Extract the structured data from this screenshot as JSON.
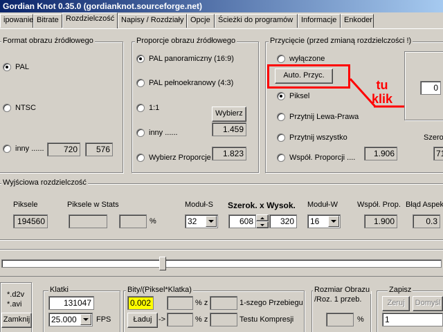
{
  "window": {
    "title": "Gordian Knot 0.35.0  (gordianknot.sourceforge.net)"
  },
  "tabs": [
    "ipowanie",
    "Bitrate",
    "Rozdzielczość",
    "Napisy / Rozdziały",
    "Opcje",
    "Ścieżki do programów",
    "Informacje",
    "Enkoder"
  ],
  "source_format": {
    "title": "Format obrazu źródłowego",
    "options": [
      "PAL",
      "NTSC",
      "inny ......"
    ],
    "selected": "PAL",
    "custom_width": "720",
    "custom_height": "576"
  },
  "source_aspect": {
    "title": "Proporcje obrazu źródłowego",
    "options": [
      "PAL panoramiczny (16:9)",
      "PAL pełnoekranowy (4:3)",
      "1:1",
      "inny ......",
      "Wybierz Proporcje"
    ],
    "selected": "PAL panoramiczny (16:9)",
    "choose_button": "Wybierz",
    "custom_value": "1.459",
    "chosen_value": "1.823"
  },
  "crop": {
    "title": "Przycięcie (przed zmianą rozdzielczości !)",
    "options": [
      "wyłączone",
      "Piksel",
      "Przytnij Lewa-Prawa",
      "Przytnij wszystko",
      "Współ. Proporcji  ...."
    ],
    "selected": "Piksel",
    "auto_button": "Auto. Przyc.",
    "aspect_value": "1.906",
    "side_value": "0",
    "width_label": "Szero",
    "width_value": "71"
  },
  "annotation": {
    "line1": "tu",
    "line2": "klik",
    "color": "#ff0000"
  },
  "output": {
    "title": "Wyjściowa rozdzielczość",
    "pixels_label": "Piksele",
    "pixels_value": "194560",
    "pixels_stats_label": "Piksele w Stats",
    "pixels_stats_value": "",
    "percent_value": "",
    "percent_sign": "%",
    "mod_s_label": "Moduł-S",
    "mod_s_value": "32",
    "size_label_w": "Szerok.",
    "size_label_x": "x",
    "size_label_h": "Wysok.",
    "width": "608",
    "height": "320",
    "mod_w_label": "Moduł-W",
    "mod_w_value": "16",
    "aspect_label": "Współ. Prop.",
    "aspect_value": "1.900",
    "aspect_error_label": "Błąd Aspek",
    "aspect_error_value": "0.3"
  },
  "slider": {
    "position": 0.365
  },
  "bottom": {
    "ext_d2v": "*.d2v",
    "ext_avi": "*.avi",
    "close_button": "Zamknij",
    "frames_title": "Klatki",
    "frames_value": "131047",
    "fps_value": "25.000",
    "fps_label": "FPS",
    "bits_title": "Bity/(Piksel*Klatka)",
    "bits_value": "0.002",
    "load_button": "Ładuj",
    "arrow": "->",
    "pct_z_1": "% z",
    "pct_z_2": "% z",
    "first_pass_label": "1-szego Przebiegu",
    "test_label": "Testu Kompresji",
    "size_title_1": "Rozmiar Obrazu",
    "size_title_2": "/Roz. 1 przeb.",
    "size_pct": "%",
    "save_title": "Zapisz",
    "clear_button": "Zeruj",
    "default_button": "Domyśl",
    "save_combo_value": "1"
  }
}
